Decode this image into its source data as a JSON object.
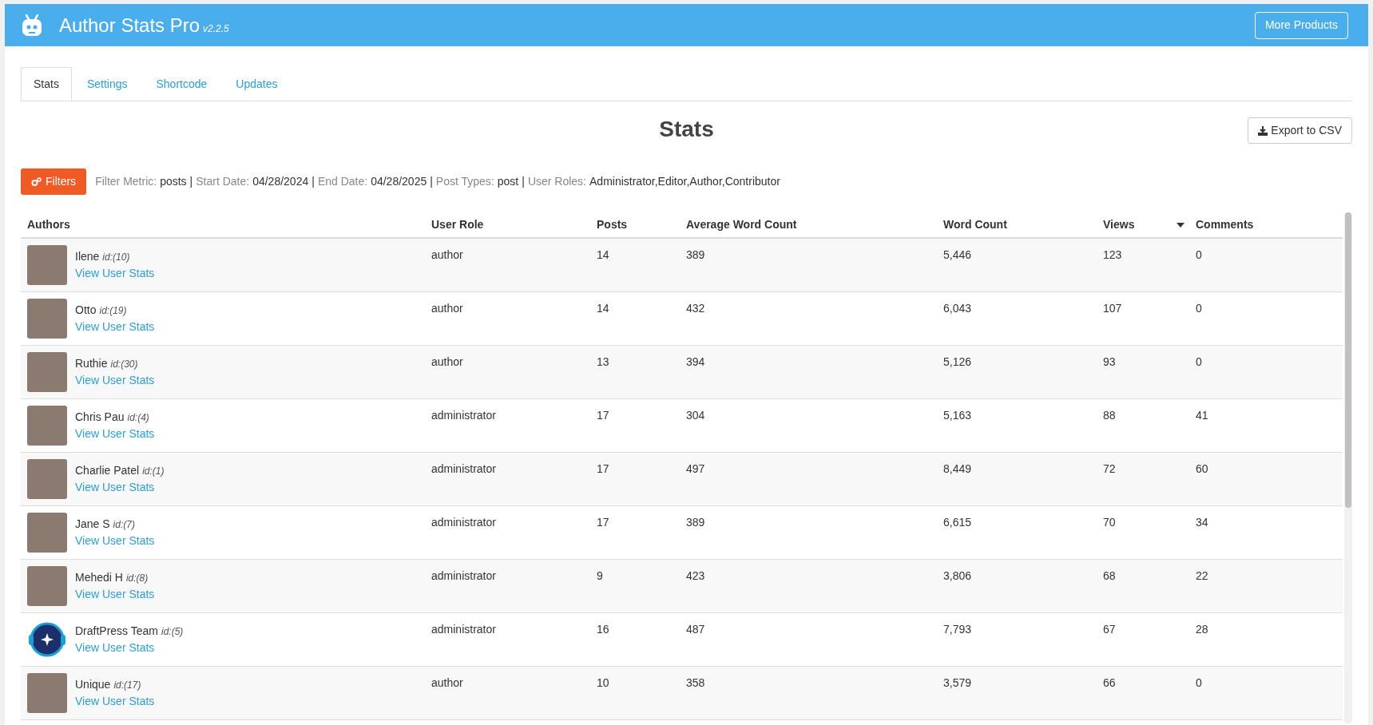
{
  "header": {
    "title": "Author Stats Pro",
    "version": "v2.2.5",
    "button": "More Products"
  },
  "tabs": [
    {
      "label": "Stats",
      "selected": true
    },
    {
      "label": "Settings",
      "selected": false
    },
    {
      "label": "Shortcode",
      "selected": false
    },
    {
      "label": "Updates",
      "selected": false
    }
  ],
  "page_title": "Stats",
  "export_button": "Export to CSV",
  "filters": {
    "button": "Filters",
    "separator": "|",
    "items": [
      {
        "label": "Filter Metric:",
        "value": "posts"
      },
      {
        "label": "Start Date:",
        "value": "04/28/2024"
      },
      {
        "label": "End Date:",
        "value": "04/28/2025"
      },
      {
        "label": "Post Types:",
        "value": "post"
      },
      {
        "label": "User Roles:",
        "value": "Administrator,Editor,Author,Contributor"
      }
    ]
  },
  "table": {
    "columns": [
      {
        "label": "Authors",
        "sorted": false
      },
      {
        "label": "User Role",
        "sorted": false
      },
      {
        "label": "Posts",
        "sorted": false
      },
      {
        "label": "Average Word Count",
        "sorted": false
      },
      {
        "label": "Word Count",
        "sorted": false
      },
      {
        "label": "Views",
        "sorted": true
      },
      {
        "label": "Comments",
        "sorted": false
      }
    ],
    "rows": [
      {
        "name": "Ilene",
        "id": "id:(10)",
        "kind": "photo",
        "link": "View User Stats",
        "role": "author",
        "posts": "14",
        "avg": "389",
        "words": "5,446",
        "views": "123",
        "comments": "0"
      },
      {
        "name": "Otto",
        "id": "id:(19)",
        "kind": "photo",
        "link": "View User Stats",
        "role": "author",
        "posts": "14",
        "avg": "432",
        "words": "6,043",
        "views": "107",
        "comments": "0"
      },
      {
        "name": "Ruthie",
        "id": "id:(30)",
        "kind": "photo",
        "link": "View User Stats",
        "role": "author",
        "posts": "13",
        "avg": "394",
        "words": "5,126",
        "views": "93",
        "comments": "0"
      },
      {
        "name": "Chris Pau",
        "id": "id:(4)",
        "kind": "photo",
        "link": "View User Stats",
        "role": "administrator",
        "posts": "17",
        "avg": "304",
        "words": "5,163",
        "views": "88",
        "comments": "41"
      },
      {
        "name": "Charlie Patel",
        "id": "id:(1)",
        "kind": "photo",
        "link": "View User Stats",
        "role": "administrator",
        "posts": "17",
        "avg": "497",
        "words": "8,449",
        "views": "72",
        "comments": "60"
      },
      {
        "name": "Jane S",
        "id": "id:(7)",
        "kind": "photo",
        "link": "View User Stats",
        "role": "administrator",
        "posts": "17",
        "avg": "389",
        "words": "6,615",
        "views": "70",
        "comments": "34"
      },
      {
        "name": "Mehedi H",
        "id": "id:(8)",
        "kind": "photo",
        "link": "View User Stats",
        "role": "administrator",
        "posts": "9",
        "avg": "423",
        "words": "3,806",
        "views": "68",
        "comments": "22"
      },
      {
        "name": "DraftPress Team",
        "id": "id:(5)",
        "kind": "logo",
        "link": "View User Stats",
        "role": "administrator",
        "posts": "16",
        "avg": "487",
        "words": "7,793",
        "views": "67",
        "comments": "28"
      },
      {
        "name": "Unique",
        "id": "id:(17)",
        "kind": "photo",
        "link": "View User Stats",
        "role": "author",
        "posts": "10",
        "avg": "358",
        "words": "3,579",
        "views": "66",
        "comments": "0"
      }
    ]
  }
}
